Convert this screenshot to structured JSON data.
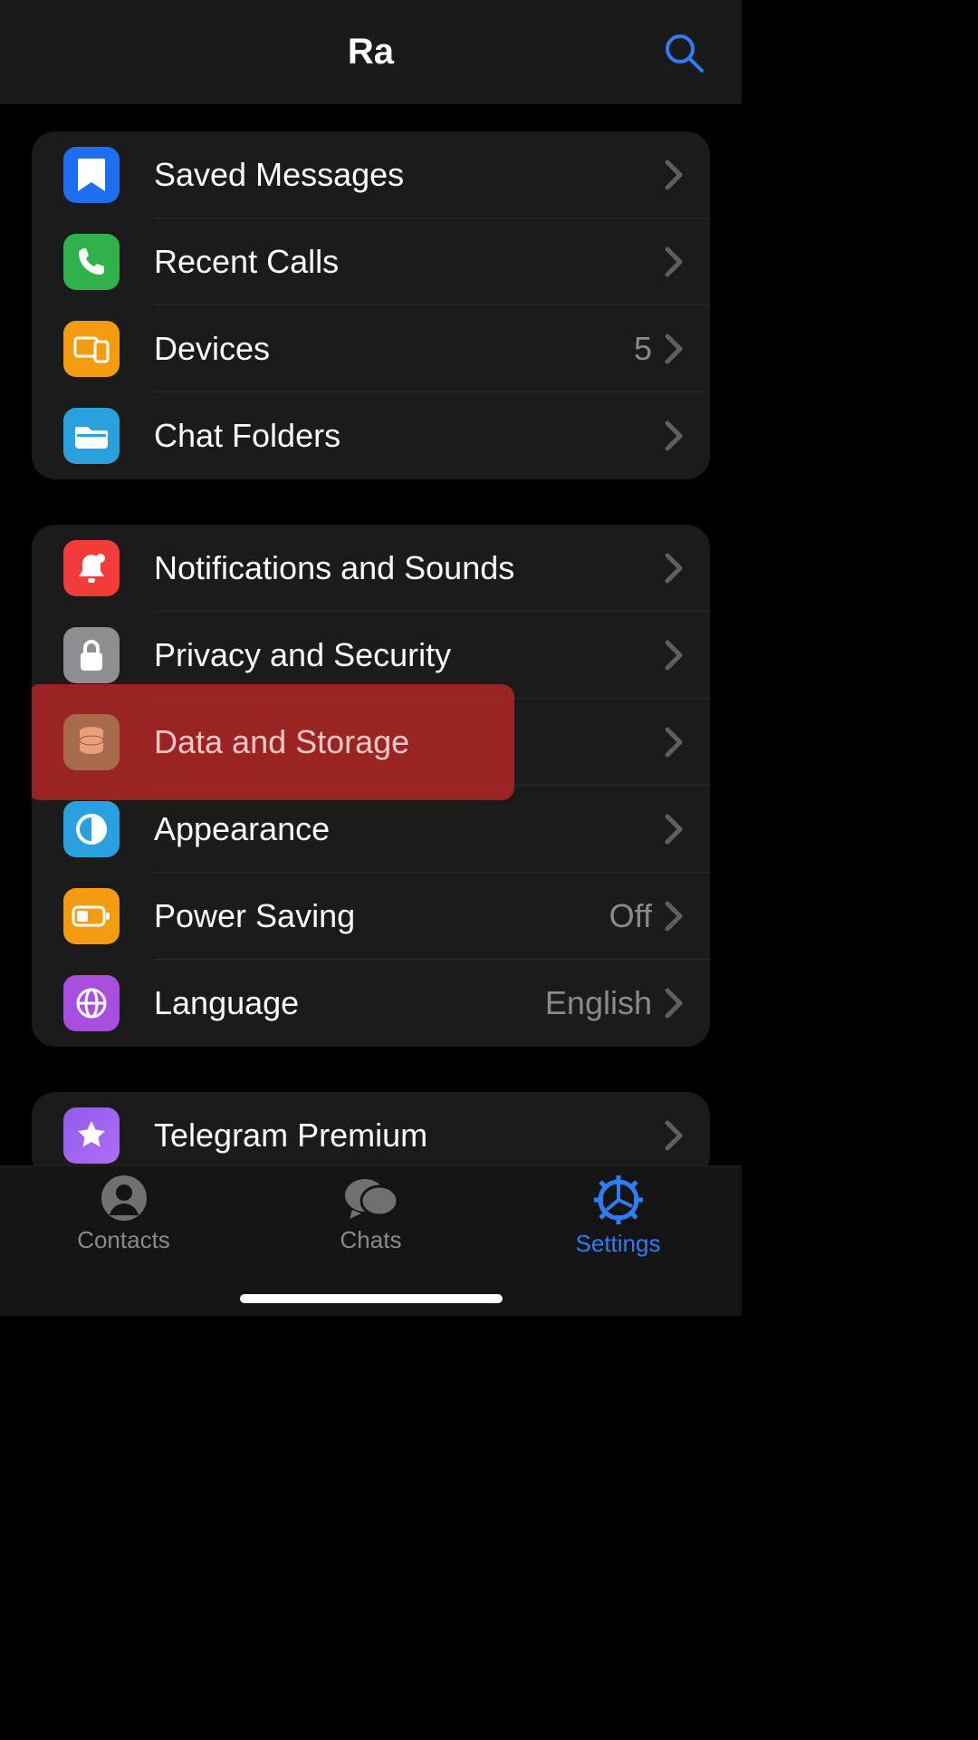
{
  "header": {
    "title": "Ra"
  },
  "groups": [
    {
      "rows": [
        {
          "icon": "bookmark",
          "icon_bg": "#1e6ef2",
          "label": "Saved Messages",
          "value": ""
        },
        {
          "icon": "phone",
          "icon_bg": "#2fb24c",
          "label": "Recent Calls",
          "value": ""
        },
        {
          "icon": "devices",
          "icon_bg": "#f39c12",
          "label": "Devices",
          "value": "5"
        },
        {
          "icon": "folder",
          "icon_bg": "#2aa1de",
          "label": "Chat Folders",
          "value": ""
        }
      ]
    },
    {
      "rows": [
        {
          "icon": "bell",
          "icon_bg": "#f23b3b",
          "label": "Notifications and Sounds",
          "value": ""
        },
        {
          "icon": "lock",
          "icon_bg": "#8e8e93",
          "label": "Privacy and Security",
          "value": ""
        },
        {
          "icon": "database",
          "icon_bg": "#2fb24c",
          "label": "Data and Storage",
          "value": "",
          "highlight": true
        },
        {
          "icon": "halfcircle",
          "icon_bg": "#2aa1de",
          "label": "Appearance",
          "value": ""
        },
        {
          "icon": "battery",
          "icon_bg": "#f39c12",
          "label": "Power Saving",
          "value": "Off"
        },
        {
          "icon": "globe",
          "icon_bg": "#a94fe0",
          "label": "Language",
          "value": "English"
        }
      ]
    },
    {
      "rows": [
        {
          "icon": "star",
          "icon_bg": "#8e5cf0",
          "label": "Telegram Premium",
          "value": ""
        }
      ]
    }
  ],
  "tabs": {
    "items": [
      {
        "icon": "contacts",
        "label": "Contacts",
        "active": false
      },
      {
        "icon": "chats",
        "label": "Chats",
        "active": false
      },
      {
        "icon": "settings",
        "label": "Settings",
        "active": true
      }
    ]
  }
}
